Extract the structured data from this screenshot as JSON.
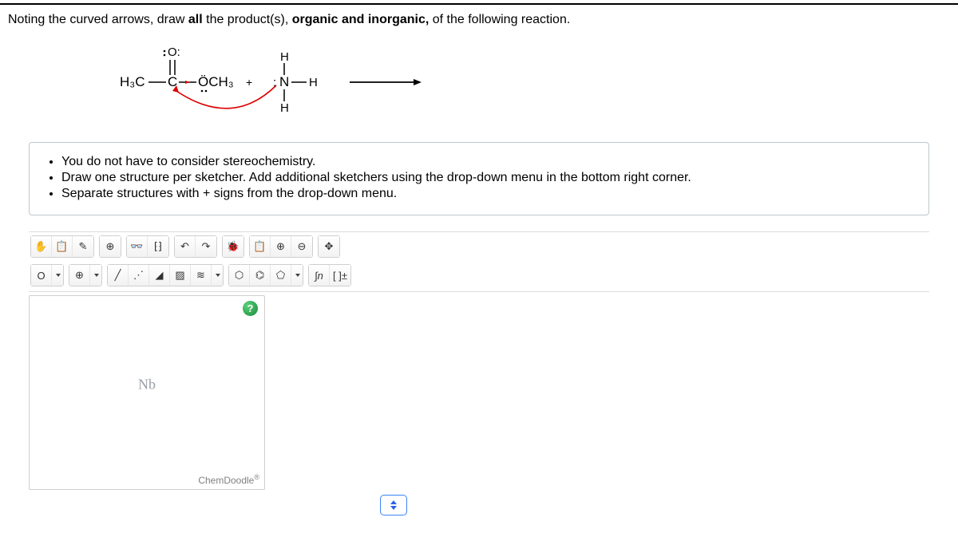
{
  "question": {
    "prefix": "Noting the curved arrows, draw ",
    "bold1": "all",
    "mid": " the product(s), ",
    "bold2": "organic and inorganic,",
    "suffix": " of the following reaction."
  },
  "reaction": {
    "reagent1": {
      "left": "H₃C",
      "c1": "C",
      "top_o": "O:",
      "leaving": "ÖCH₃"
    },
    "plus": "+",
    "reagent2": {
      "center": "N",
      "h_top": "H",
      "h_right": "H",
      "h_bottom": "H",
      "lone_pair": ":"
    }
  },
  "instructions": [
    "You do not have to consider stereochemistry.",
    "Draw one structure per sketcher. Add additional sketchers using the drop-down menu in the bottom right corner.",
    "Separate structures with + signs from the drop-down menu."
  ],
  "toolbar": {
    "row1": {
      "hand": "✋",
      "copy": "📋",
      "clear": "✎",
      "center": "⊕",
      "glasses": "👓",
      "brackets": "⁅⁆",
      "undo": "↶",
      "redo": "↷",
      "bug": "🐞",
      "paste": "📋",
      "zoom_in": "⊕",
      "zoom_out": "⊖",
      "clean": "✥"
    },
    "row2": {
      "atom_o": "O",
      "ring_plus": "⊕",
      "single": "╱",
      "dotted": "⋰",
      "wedge_up": "◢",
      "wedge_down": "▨",
      "triple": "≋",
      "hex": "⬡",
      "hex_arom": "⌬",
      "pent": "⬠",
      "curve": "∫n",
      "bracket": "[ ]±"
    }
  },
  "canvas": {
    "help": "?",
    "placeholder": "Nb",
    "brand": "ChemDoodle",
    "brand_mark": "®"
  },
  "stepper_icon": "⇅"
}
